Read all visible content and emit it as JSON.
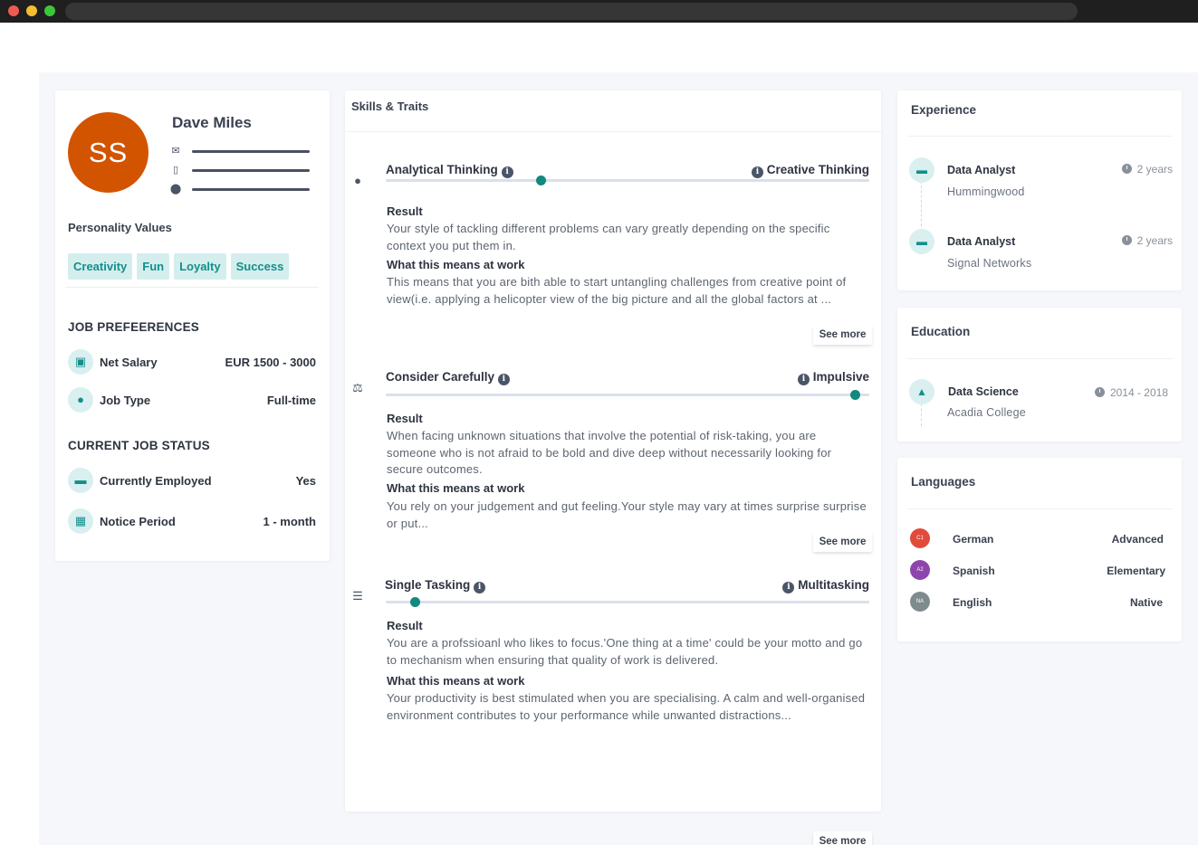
{
  "profile": {
    "initials": "SS",
    "name": "Dave Miles",
    "personality_title": "Personality Values",
    "values": [
      "Creativity",
      "Fun",
      "Loyalty",
      "Success"
    ],
    "job_pref_title": "JOB PREFEERENCES",
    "net_salary_label": "Net Salary",
    "net_salary_value": "EUR 1500 - 3000",
    "job_type_label": "Job Type",
    "job_type_value": "Full-time",
    "status_title": "CURRENT JOB STATUS",
    "employed_label": "Currently Employed",
    "employed_value": "Yes",
    "notice_label": "Notice Period",
    "notice_value": "1 - month",
    "avatar_color": "#d35400"
  },
  "skills": {
    "title": "Skills & Traits",
    "result_label": "Result",
    "meaning_label": "What this means at work",
    "see_more": "See more",
    "traits": [
      {
        "left": "Analytical Thinking",
        "right": "Creative Thinking",
        "level_pct": 32,
        "result": "Your style of tackling different problems can vary greatly depending on the specific context you put them in.",
        "meaning": "This means that you are bith able to start untangling challenges from creative point of view(i.e. applying a helicopter view of the big picture and all the global factors at ..."
      },
      {
        "left": "Consider Carefully",
        "right": "Impulsive",
        "level_pct": 97,
        "result": "When facing unknown situations that involve the potential of risk-taking, you are someone who is not afraid to be bold and dive deep without necessarily looking for secure outcomes.",
        "meaning": "You rely on your judgement and gut feeling.Your style may vary at times surprise surprise or put..."
      },
      {
        "left": "Single Tasking",
        "right": "Multitasking",
        "level_pct": 6,
        "result": "You are a profssioanl who likes to focus.'One thing at a time' could be your motto and go to mechanism when ensuring that quality of work is delivered.",
        "meaning": "Your productivity is best stimulated when you are specialising. A calm and well-organised environment contributes to your performance while unwanted distractions..."
      }
    ]
  },
  "experience": {
    "title": "Experience",
    "items": [
      {
        "role": "Data Analyst",
        "company": "Hummingwood",
        "duration": "2 years"
      },
      {
        "role": "Data Analyst",
        "company": "Signal Networks",
        "duration": "2 years"
      }
    ]
  },
  "education": {
    "title": "Education",
    "items": [
      {
        "degree": "Data Science",
        "school": "Acadia College",
        "years": "2014 - 2018"
      }
    ]
  },
  "languages": {
    "title": "Languages",
    "items": [
      {
        "badge": "C1",
        "name": "German",
        "level": "Advanced",
        "color": "#e14b3b"
      },
      {
        "badge": "A2",
        "name": "Spanish",
        "level": "Elementary",
        "color": "#8e44ad"
      },
      {
        "badge": "NA",
        "name": "English",
        "level": "Native",
        "color": "#7f8c8d"
      }
    ]
  },
  "colors": {
    "accent": "#138f8b",
    "chip_bg": "#d4eeee"
  }
}
